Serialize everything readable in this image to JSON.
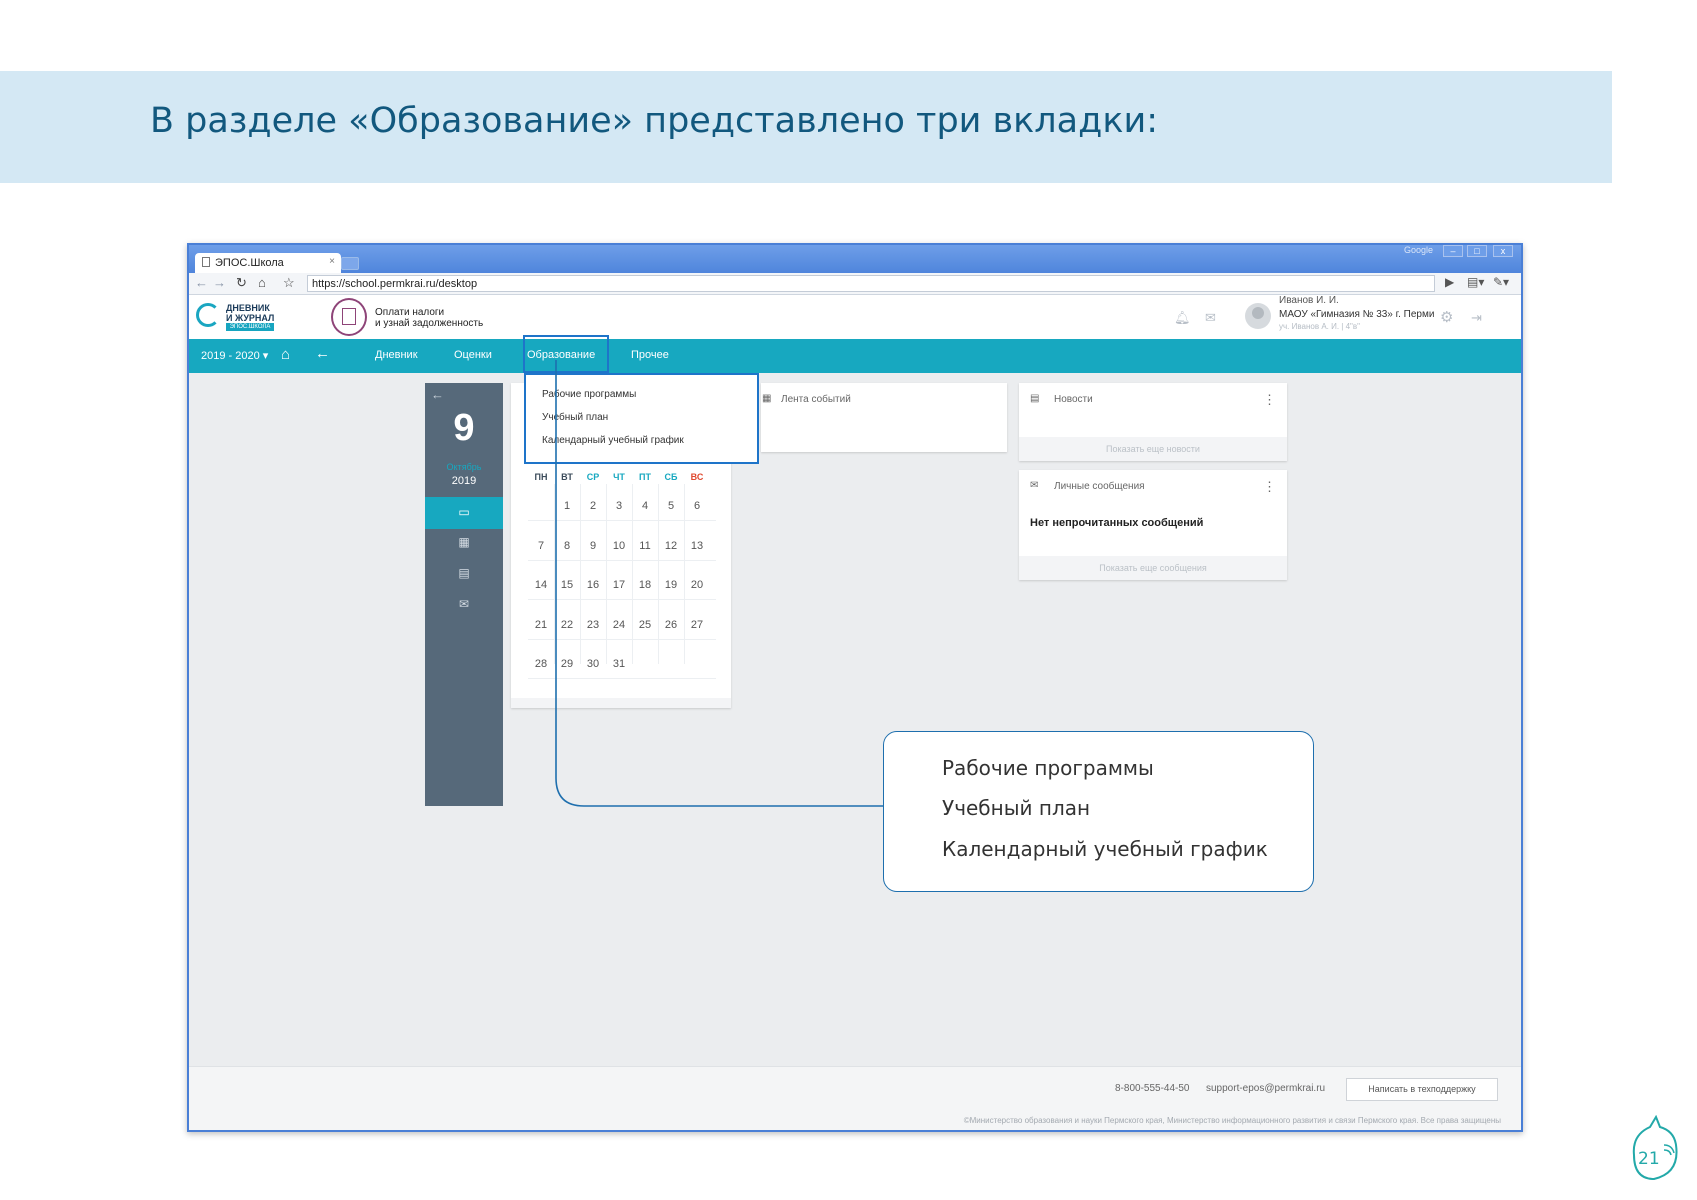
{
  "banner": {
    "title": "В разделе «Образование» представлено три вкладки:"
  },
  "browser": {
    "tab_title": "ЭПОС.Школа",
    "tab_close": "×",
    "google_label": "Google",
    "window_buttons": [
      "–",
      "□",
      "x"
    ],
    "url": "https://school.permkrai.ru/desktop"
  },
  "header": {
    "logo_line1": "ДНЕВНИК",
    "logo_line2": "И ЖУРНАЛ",
    "logo_badge": "ЭПОС.ШКОЛА",
    "tax_line1": "Оплати налоги",
    "tax_line2": "и узнай задолженность",
    "user_name": "Иванов И. И.",
    "user_school": "МАОУ «Гимназия № 33» г. Перми",
    "user_class": "уч. Иванов А. И. | 4\"в\""
  },
  "nav": {
    "year": "2019 - 2020 ▾",
    "items": [
      "Дневник",
      "Оценки",
      "Образование",
      "Прочее"
    ]
  },
  "dropdown": {
    "items": [
      "Рабочие программы",
      "Учебный план",
      "Календарный учебный график"
    ]
  },
  "date_panel": {
    "day": "9",
    "month": "Октябрь",
    "year": "2019"
  },
  "calendar": {
    "weekdays": [
      "ПН",
      "ВТ",
      "СР",
      "ЧТ",
      "ПТ",
      "СБ",
      "ВС"
    ],
    "weekday_colors": [
      "#3b4b5a",
      "#3b4b5a",
      "#17a8c0",
      "#17a8c0",
      "#17a8c0",
      "#17a8c0",
      "#e0492f"
    ],
    "weeks": [
      [
        "",
        "1",
        "2",
        "3",
        "4",
        "5",
        "6"
      ],
      [
        "7",
        "8",
        "9",
        "10",
        "11",
        "12",
        "13"
      ],
      [
        "14",
        "15",
        "16",
        "17",
        "18",
        "19",
        "20"
      ],
      [
        "21",
        "22",
        "23",
        "24",
        "25",
        "26",
        "27"
      ],
      [
        "28",
        "29",
        "30",
        "31",
        "",
        "",
        ""
      ]
    ]
  },
  "feed": {
    "title": "Лента событий"
  },
  "news": {
    "title": "Новости",
    "more": "Показать еще новости"
  },
  "messages": {
    "title": "Личные сообщения",
    "body": "Нет непрочитанных сообщений",
    "more": "Показать еще сообщения"
  },
  "footer": {
    "phone": "8-800-555-44-50",
    "email": "support-epos@permkrai.ru",
    "support_button": "Написать в техподдержку",
    "copyright": "©Министерство образования и науки Пермского края, Министерство информационного развития и связи Пермского края. Все права защищены"
  },
  "callout": {
    "items": [
      "Рабочие программы",
      "Учебный план",
      "Календарный учебный график"
    ]
  },
  "page_logo": {
    "number": "21"
  },
  "colors": {
    "accent": "#17a8c0",
    "highlight": "#1e74c9",
    "sidebar": "#56697a",
    "banner": "#d4e8f4",
    "title": "#12587e"
  },
  "icons": [
    "back-arrow-icon",
    "forward-arrow-icon",
    "reload-icon",
    "home-icon",
    "star-icon",
    "play-icon",
    "page-icon",
    "wrench-icon",
    "bell-icon",
    "mail-icon",
    "gear-icon",
    "logout-icon",
    "calendar-icon",
    "chat-icon",
    "menu-dots-icon"
  ]
}
